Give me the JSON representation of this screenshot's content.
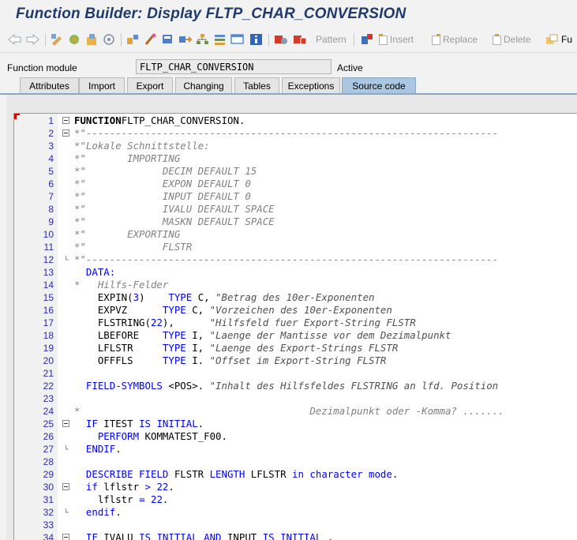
{
  "window": {
    "title": "Function Builder: Display FLTP_CHAR_CONVERSION"
  },
  "toolbar": {
    "back_icon": "arrow-left-icon",
    "forward_icon": "arrow-right-icon",
    "pattern_label": "Pattern",
    "insert_label": "Insert",
    "replace_label": "Replace",
    "delete_label": "Delete",
    "cut_label": "Fu"
  },
  "function_module": {
    "label": "Function module",
    "value": "FLTP_CHAR_CONVERSION",
    "status": "Active"
  },
  "tabs": [
    {
      "label": "Attributes",
      "active": false
    },
    {
      "label": "Import",
      "active": false
    },
    {
      "label": "Export",
      "active": false
    },
    {
      "label": "Changing",
      "active": false
    },
    {
      "label": "Tables",
      "active": false
    },
    {
      "label": "Exceptions",
      "active": false
    },
    {
      "label": "Source code",
      "active": true
    }
  ],
  "lines": [
    {
      "n": "1",
      "fold": "minus",
      "tokens": [
        [
          "kwb",
          "FUNCTION"
        ],
        [
          "",
          "FLTP_CHAR_CONVERSION."
        ]
      ],
      "sep": ""
    },
    {
      "n": "2",
      "fold": "minus",
      "tokens": [
        [
          "cm",
          "*\"----------------------------------------------------------------------"
        ]
      ]
    },
    {
      "n": "3",
      "fold": "",
      "tokens": [
        [
          "cm",
          "*\"Lokale Schnittstelle:"
        ]
      ]
    },
    {
      "n": "4",
      "fold": "",
      "tokens": [
        [
          "cm",
          "*\"       IMPORTING"
        ]
      ]
    },
    {
      "n": "5",
      "fold": "",
      "tokens": [
        [
          "cm",
          "*\"             DECIM DEFAULT 15"
        ]
      ]
    },
    {
      "n": "6",
      "fold": "",
      "tokens": [
        [
          "cm",
          "*\"             EXPON DEFAULT 0"
        ]
      ]
    },
    {
      "n": "7",
      "fold": "",
      "tokens": [
        [
          "cm",
          "*\"             INPUT DEFAULT 0"
        ]
      ]
    },
    {
      "n": "8",
      "fold": "",
      "tokens": [
        [
          "cm",
          "*\"             IVALU DEFAULT SPACE"
        ]
      ]
    },
    {
      "n": "9",
      "fold": "",
      "tokens": [
        [
          "cm",
          "*\"             MASKN DEFAULT SPACE"
        ]
      ]
    },
    {
      "n": "10",
      "fold": "",
      "tokens": [
        [
          "cm",
          "*\"       EXPORTING"
        ]
      ]
    },
    {
      "n": "11",
      "fold": "",
      "tokens": [
        [
          "cm",
          "*\"             FLSTR"
        ]
      ]
    },
    {
      "n": "12",
      "fold": "end",
      "tokens": [
        [
          "cm",
          "*\"----------------------------------------------------------------------"
        ]
      ]
    },
    {
      "n": "13",
      "fold": "",
      "tokens": [
        [
          "kw",
          "  DATA:"
        ]
      ]
    },
    {
      "n": "14",
      "fold": "",
      "tokens": [
        [
          "cm",
          "*   Hilfs-Felder"
        ]
      ]
    },
    {
      "n": "15",
      "fold": "",
      "tokens": [
        [
          "",
          "    EXPIN("
        ],
        [
          "num",
          "3"
        ],
        [
          "",
          ")    "
        ],
        [
          "kw",
          "TYPE"
        ],
        [
          "",
          " C, "
        ],
        [
          "st",
          "\"Betrag des 10er-Exponenten"
        ]
      ]
    },
    {
      "n": "16",
      "fold": "",
      "tokens": [
        [
          "",
          "    EXPVZ      "
        ],
        [
          "kw",
          "TYPE"
        ],
        [
          "",
          " C, "
        ],
        [
          "st",
          "\"Vorzeichen des 10er-Exponenten"
        ]
      ]
    },
    {
      "n": "17",
      "fold": "",
      "tokens": [
        [
          "",
          "    FLSTRING("
        ],
        [
          "num",
          "22"
        ],
        [
          "",
          "),      "
        ],
        [
          "st",
          "\"Hilfsfeld fuer Export-String FLSTR"
        ]
      ]
    },
    {
      "n": "18",
      "fold": "",
      "tokens": [
        [
          "",
          "    LBEFORE    "
        ],
        [
          "kw",
          "TYPE"
        ],
        [
          "",
          " I, "
        ],
        [
          "st",
          "\"Laenge der Mantisse vor dem Dezimalpunkt"
        ]
      ]
    },
    {
      "n": "19",
      "fold": "",
      "tokens": [
        [
          "",
          "    LFLSTR     "
        ],
        [
          "kw",
          "TYPE"
        ],
        [
          "",
          " I, "
        ],
        [
          "st",
          "\"Laenge des Export-Strings FLSTR"
        ]
      ]
    },
    {
      "n": "20",
      "fold": "",
      "tokens": [
        [
          "",
          "    OFFFLS     "
        ],
        [
          "kw",
          "TYPE"
        ],
        [
          "",
          " I. "
        ],
        [
          "st",
          "\"Offset im Export-String FLSTR"
        ]
      ]
    },
    {
      "n": "21",
      "fold": "",
      "tokens": []
    },
    {
      "n": "22",
      "fold": "",
      "tokens": [
        [
          "kw",
          "  FIELD-SYMBOLS"
        ],
        [
          "",
          " <POS>. "
        ],
        [
          "st",
          "\"Inhalt des Hilfsfeldes FLSTRING an lfd. Position"
        ]
      ]
    },
    {
      "n": "23",
      "fold": "",
      "tokens": []
    },
    {
      "n": "24",
      "fold": "",
      "tokens": [
        [
          "cm",
          "*                                       Dezimalpunkt oder -Komma? ......."
        ]
      ]
    },
    {
      "n": "25",
      "fold": "minus",
      "tokens": [
        [
          "kw",
          "  IF"
        ],
        [
          "",
          " ITEST "
        ],
        [
          "kw",
          "IS INITIAL"
        ],
        [
          "",
          "."
        ]
      ]
    },
    {
      "n": "26",
      "fold": "",
      "tokens": [
        [
          "kw",
          "    PERFORM"
        ],
        [
          "",
          " KOMMATEST_F00."
        ]
      ]
    },
    {
      "n": "27",
      "fold": "end",
      "tokens": [
        [
          "kw",
          "  ENDIF"
        ],
        [
          "",
          "."
        ]
      ]
    },
    {
      "n": "28",
      "fold": "",
      "tokens": []
    },
    {
      "n": "29",
      "fold": "",
      "tokens": [
        [
          "kw",
          "  DESCRIBE FIELD"
        ],
        [
          "",
          " FLSTR "
        ],
        [
          "kw",
          "LENGTH"
        ],
        [
          "",
          " LFLSTR "
        ],
        [
          "kw",
          "in character mode"
        ],
        [
          "",
          "."
        ]
      ]
    },
    {
      "n": "30",
      "fold": "minus",
      "tokens": [
        [
          "kw",
          "  if"
        ],
        [
          "",
          " lflstr "
        ],
        [
          "kw",
          ">"
        ],
        [
          " num",
          " 22"
        ],
        [
          "",
          "."
        ]
      ]
    },
    {
      "n": "31",
      "fold": "",
      "tokens": [
        [
          "",
          "    lflstr "
        ],
        [
          "kw",
          "="
        ],
        [
          "num",
          " 22"
        ],
        [
          "",
          "."
        ]
      ]
    },
    {
      "n": "32",
      "fold": "end",
      "tokens": [
        [
          "kw",
          "  endif"
        ],
        [
          "",
          "."
        ]
      ]
    },
    {
      "n": "33",
      "fold": "",
      "tokens": []
    },
    {
      "n": "34",
      "fold": "minus",
      "tokens": [
        [
          "kw",
          "  IF"
        ],
        [
          "",
          " IVALU "
        ],
        [
          "kw",
          "IS INITIAL AND"
        ],
        [
          "",
          " INPUT "
        ],
        [
          "kw",
          "IS INITIAL"
        ],
        [
          "",
          " ."
        ]
      ]
    }
  ]
}
